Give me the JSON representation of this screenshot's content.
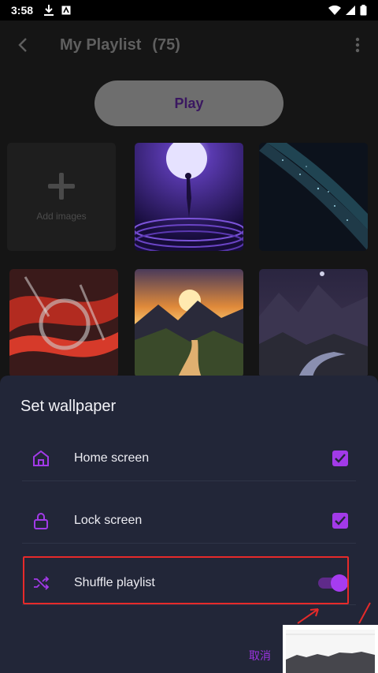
{
  "status_bar": {
    "time": "3:58"
  },
  "app_bar": {
    "title": "My Playlist",
    "count": "(75)"
  },
  "play_button": {
    "label": "Play"
  },
  "grid": {
    "add_images_label": "Add images"
  },
  "sheet": {
    "title": "Set wallpaper",
    "rows": [
      {
        "label": "Home screen",
        "icon": "home-icon",
        "control": "checkbox",
        "checked": true
      },
      {
        "label": "Lock screen",
        "icon": "lock-icon",
        "control": "checkbox",
        "checked": true
      },
      {
        "label": "Shuffle playlist",
        "icon": "shuffle-icon",
        "control": "toggle",
        "on": true
      }
    ],
    "cancel_label": "取消"
  },
  "colors": {
    "accent": "#a23ae8",
    "sheet_bg": "#222638",
    "highlight": "#e62a2a"
  }
}
